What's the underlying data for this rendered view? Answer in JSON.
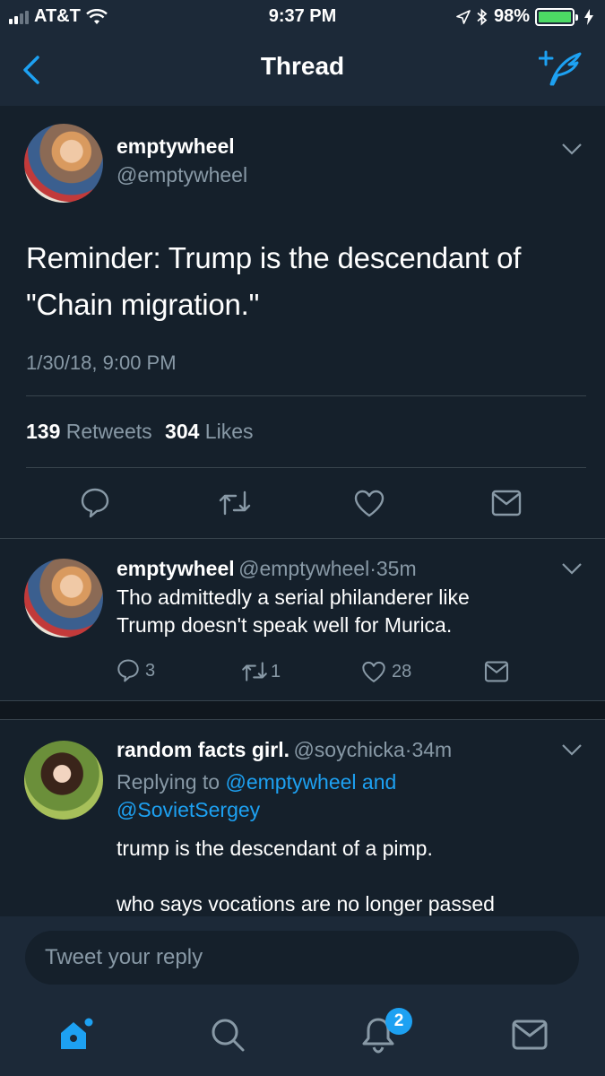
{
  "status_bar": {
    "carrier": "AT&T",
    "time": "9:37 PM",
    "battery": "98%",
    "battery_level": 0.98,
    "icons": [
      "signal-icon",
      "wifi-icon",
      "location-arrow-icon",
      "bluetooth-icon",
      "battery-icon",
      "charging-bolt-icon"
    ]
  },
  "nav": {
    "title": "Thread",
    "icons": [
      "back-chevron-icon",
      "compose-tweet-icon"
    ]
  },
  "main_tweet": {
    "name": "emptywheel",
    "handle": "@emptywheel",
    "text_line1": "Reminder: Trump is the descendant of",
    "text_line2": "\"Chain migration.\"",
    "timestamp": "1/30/18, 9:00 PM",
    "retweet_count": "139",
    "retweet_label": "Retweets",
    "like_count": "304",
    "like_label": "Likes",
    "actions": [
      "reply-icon",
      "retweet-icon",
      "like-icon",
      "direct-message-icon"
    ]
  },
  "replies": [
    {
      "name": "emptywheel",
      "handle": "@emptywheel",
      "sep": "·",
      "time": "35m",
      "text_line1": "Tho admittedly a serial philanderer like",
      "text_line2": "Trump doesn't speak well for Murica.",
      "reply_count": "3",
      "retweet_count": "1",
      "like_count": "28"
    },
    {
      "name": "random facts girl.",
      "handle": "@soychicka",
      "sep": "·",
      "time": "34m",
      "replying_prefix": "Replying to",
      "replying_to_1": "@emptywheel and",
      "replying_to_2": "@SovietSergey",
      "text_line1": "trump is the descendant of a pimp.",
      "text_line2": "who says vocations are no longer passed"
    }
  ],
  "reply_box": {
    "placeholder": "Tweet your reply"
  },
  "tab_bar": {
    "items": [
      "home-icon",
      "search-icon",
      "notifications-icon",
      "messages-icon"
    ],
    "notifications_badge": "2"
  },
  "colors": {
    "background": "#15202b",
    "bars": "#1c2938",
    "accent": "#1da1f2",
    "muted": "#8899a6",
    "divider": "#38444d"
  }
}
